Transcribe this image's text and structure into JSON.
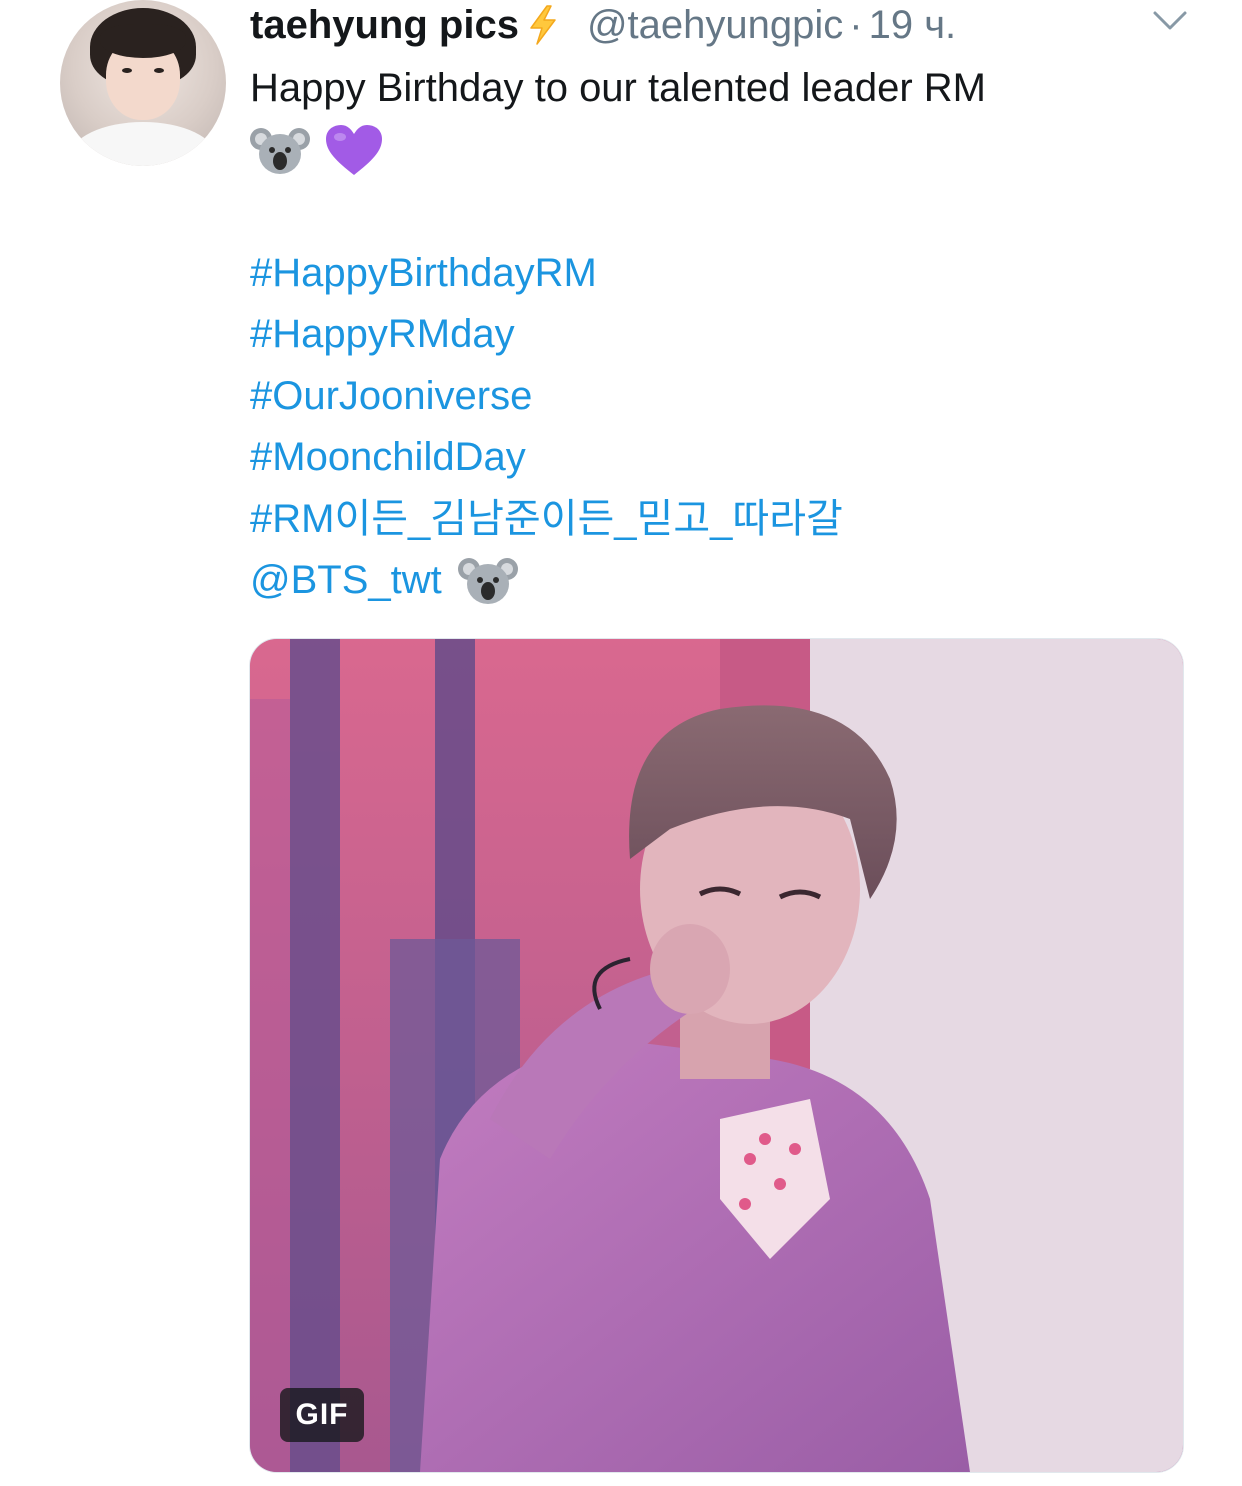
{
  "tweet": {
    "display_name": "taehyung pics",
    "handle": "@taehyungpic",
    "separator": "·",
    "time": "19 ч.",
    "text_line1": "Happy Birthday to our talented leader RM",
    "emojis": [
      "koala-icon",
      "purple-heart-icon"
    ],
    "hashtags": [
      "#HappyBirthdayRM",
      "#HappyRMday",
      "#OurJooniverse",
      "#MoonchildDay",
      "#RM이든_김남준이든_믿고_따라갈"
    ],
    "mention": "@BTS_twt",
    "media": {
      "badge": "GIF"
    }
  },
  "colors": {
    "link": "#1b95e0",
    "text": "#14171a",
    "secondary": "#657786",
    "bolt": "#ffc83d",
    "purple_heart": "#a25be6"
  }
}
